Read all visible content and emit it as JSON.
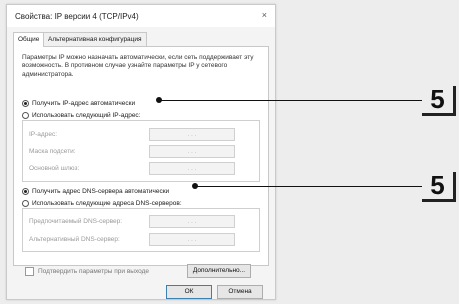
{
  "window": {
    "title": "Свойства: IP версии 4 (TCP/IPv4)",
    "close_glyph": "×"
  },
  "tabs": [
    {
      "label": "Общие",
      "active": true
    },
    {
      "label": "Альтернативная конфигурация",
      "active": false
    }
  ],
  "description": "Параметры IP можно назначать автоматически, если сеть поддерживает эту возможность. В противном случае узнайте параметры IP у сетевого администратора.",
  "ip": {
    "auto_label": "Получить IP-адрес автоматически",
    "auto_selected": true,
    "manual_label": "Использовать следующий IP-адрес:",
    "fields": [
      {
        "label": "IP-адрес:",
        "value": ". . ."
      },
      {
        "label": "Маска подсети:",
        "value": ". . ."
      },
      {
        "label": "Основной шлюз:",
        "value": ". . ."
      }
    ]
  },
  "dns": {
    "auto_label": "Получить адрес DNS-сервера автоматически",
    "auto_selected": true,
    "manual_label": "Использовать следующие адреса DNS-серверов:",
    "fields": [
      {
        "label": "Предпочитаемый DNS-сервер:",
        "value": ". . ."
      },
      {
        "label": "Альтернативный DNS-сервер:",
        "value": ". . ."
      }
    ]
  },
  "validate_label": "Подтвердить параметры при выходе",
  "advanced_button": "Дополнительно...",
  "ok_button": "ОК",
  "cancel_button": "Отмена",
  "callouts": [
    {
      "number": "5"
    },
    {
      "number": "5"
    }
  ]
}
